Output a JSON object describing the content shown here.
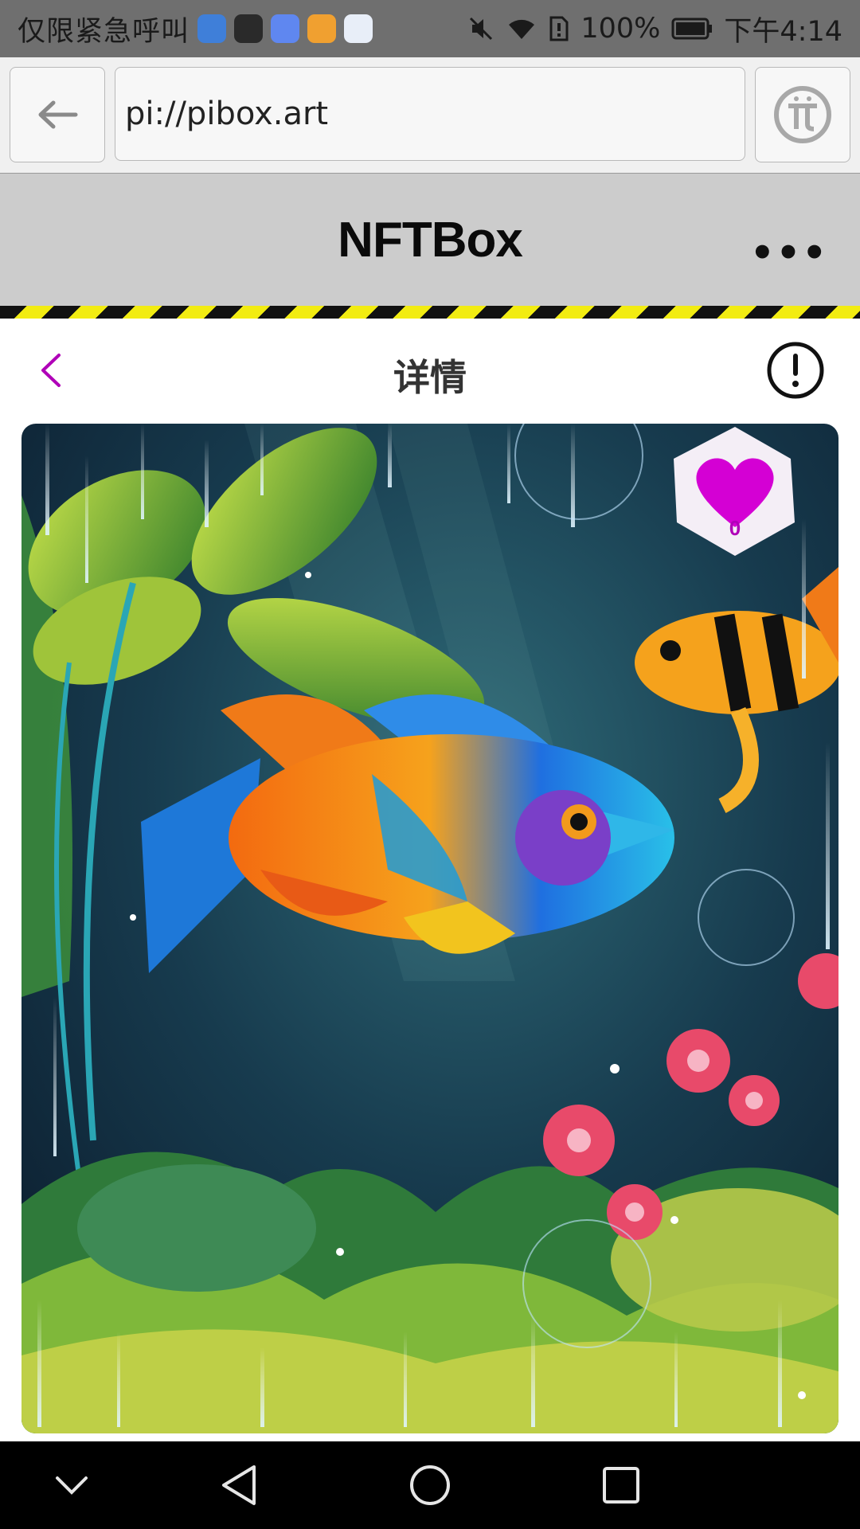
{
  "status_bar": {
    "carrier_text": "仅限紧急呼叫",
    "battery": "100%",
    "time": "下午4:14",
    "icons": [
      "browser-icon",
      "huawei-icon",
      "music-icon",
      "files-icon",
      "pi-app-icon",
      "mute-icon",
      "wifi-icon",
      "sim-icon",
      "battery-icon"
    ]
  },
  "browser": {
    "url": "pi://pibox.art",
    "back_icon": "arrow-left-icon",
    "pi_icon": "pi-logo-icon"
  },
  "app_header": {
    "title": "NFTBox",
    "more_label": "•••",
    "stripe_colors": [
      "#111111",
      "#f2ec12"
    ]
  },
  "detail": {
    "title": "详情",
    "back_icon": "chevron-left-icon",
    "info_icon": "exclamation-circle-icon",
    "accent": "#b000b8"
  },
  "artwork": {
    "like_count": "0",
    "heart_color": "#d400d4"
  },
  "nav_bar": {
    "buttons": [
      "collapse-icon",
      "back-triangle-icon",
      "home-circle-icon",
      "recents-square-icon"
    ]
  }
}
